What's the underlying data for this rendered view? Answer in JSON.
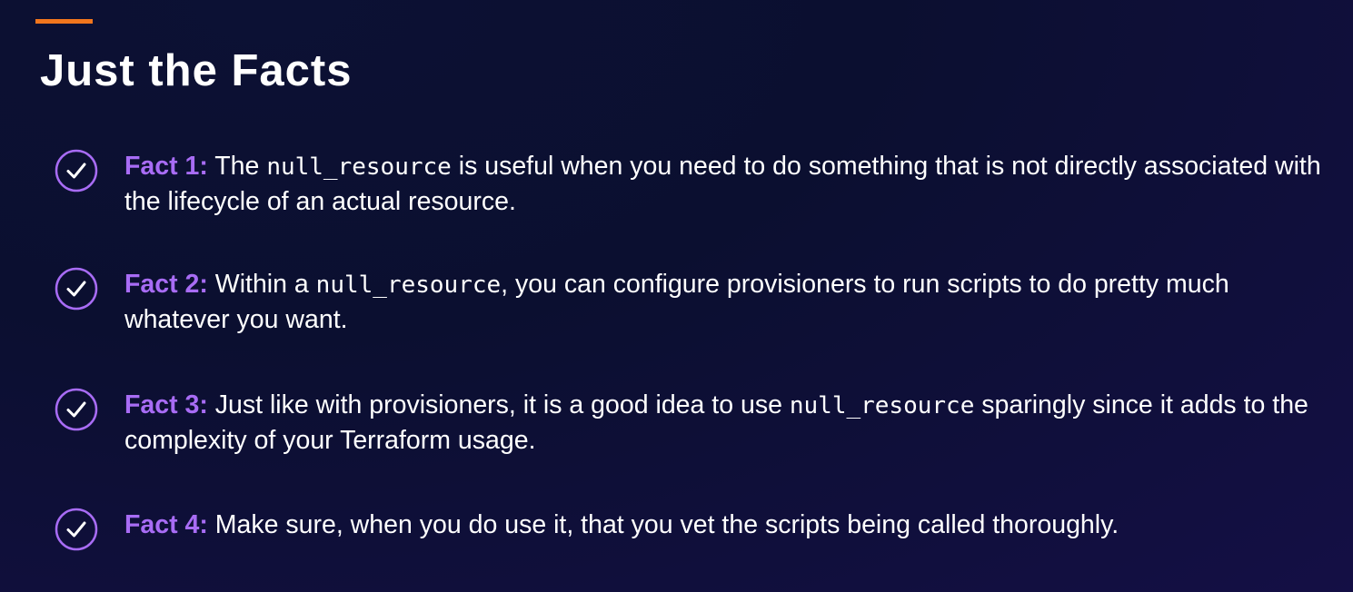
{
  "slide": {
    "title": "Just the Facts",
    "accent_color": "#f2761d",
    "label_color": "#a86cf5",
    "check_icon": "check-circle-icon",
    "facts": [
      {
        "label": "Fact 1:",
        "text_before": " The ",
        "code": "null_resource",
        "text_after": " is useful when you need to do something that is not directly associated with the lifecycle of an actual resource."
      },
      {
        "label": "Fact 2:",
        "text_before": " Within a ",
        "code": "null_resource",
        "text_after": ", you can configure provisioners to run scripts to do pretty much whatever you want."
      },
      {
        "label": "Fact 3:",
        "text_before": " Just like with provisioners, it is a good idea to use ",
        "code": "null_resource",
        "text_after": " sparingly since it adds to the complexity of your Terraform usage."
      },
      {
        "label": "Fact 4:",
        "text_before": " Make sure, when you do use it, that you vet the scripts being called thoroughly.",
        "code": "",
        "text_after": ""
      }
    ]
  }
}
